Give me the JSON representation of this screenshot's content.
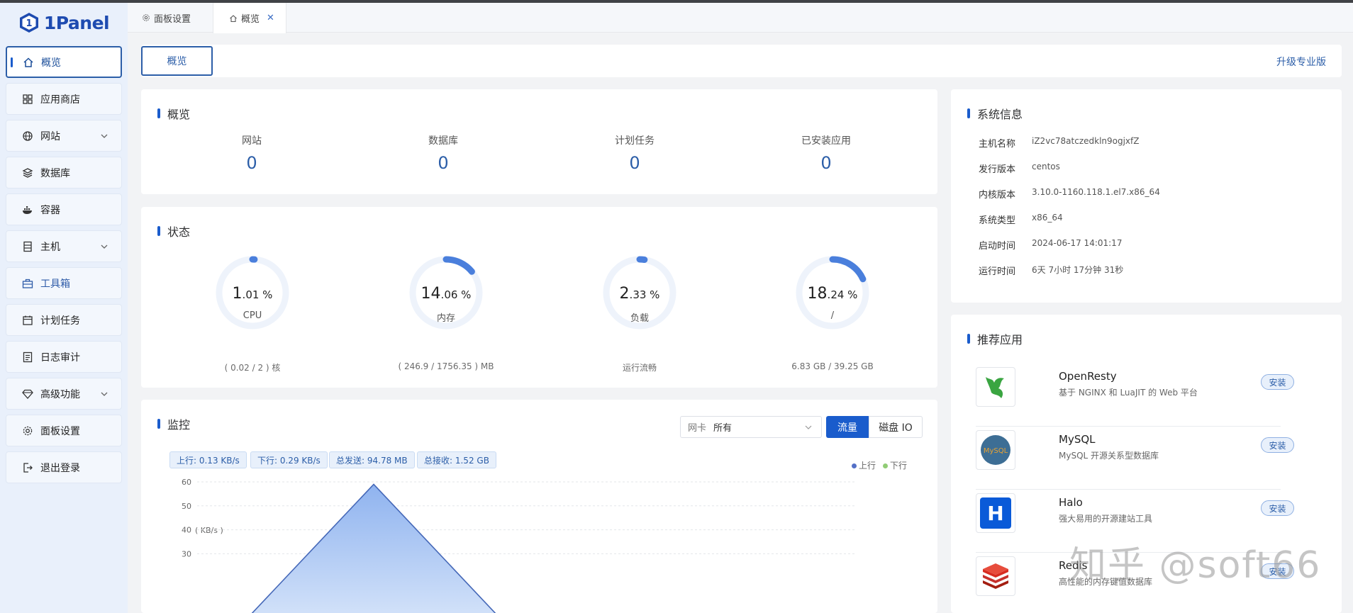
{
  "app": {
    "name": "1Panel"
  },
  "sidebar": {
    "items": [
      {
        "label": "概览",
        "icon": "home-icon"
      },
      {
        "label": "应用商店",
        "icon": "grid-icon"
      },
      {
        "label": "网站",
        "icon": "globe-icon"
      },
      {
        "label": "数据库",
        "icon": "layers-icon"
      },
      {
        "label": "容器",
        "icon": "docker-icon"
      },
      {
        "label": "主机",
        "icon": "server-icon"
      },
      {
        "label": "工具箱",
        "icon": "toolbox-icon"
      },
      {
        "label": "计划任务",
        "icon": "calendar-icon"
      },
      {
        "label": "日志审计",
        "icon": "log-icon"
      },
      {
        "label": "高级功能",
        "icon": "diamond-icon"
      },
      {
        "label": "面板设置",
        "icon": "gear-icon"
      },
      {
        "label": "退出登录",
        "icon": "logout-icon"
      }
    ]
  },
  "tabs": {
    "settings": "面板设置",
    "overview": "概览",
    "close": "✕"
  },
  "header": {
    "button": "概览",
    "upgrade": "升级专业版"
  },
  "overview": {
    "title": "概览",
    "stats": [
      {
        "label": "网站",
        "value": "0"
      },
      {
        "label": "数据库",
        "value": "0"
      },
      {
        "label": "计划任务",
        "value": "0"
      },
      {
        "label": "已安装应用",
        "value": "0"
      }
    ]
  },
  "status": {
    "title": "状态",
    "gauges": [
      {
        "int": "1",
        "dec": ".01 %",
        "name": "CPU",
        "sub": "( 0.02 / 2 ) 核",
        "percent": 1.01
      },
      {
        "int": "14",
        "dec": ".06 %",
        "name": "内存",
        "sub": "( 246.9 / 1756.35 ) MB",
        "percent": 14.06
      },
      {
        "int": "2",
        "dec": ".33 %",
        "name": "负载",
        "sub": "运行流畅",
        "percent": 2.33
      },
      {
        "int": "18",
        "dec": ".24 %",
        "name": "/",
        "sub": "6.83 GB / 39.25 GB",
        "percent": 18.24
      }
    ]
  },
  "monitor": {
    "title": "监控",
    "nic_label": "网卡",
    "nic_value": "所有",
    "btn_traffic": "流量",
    "btn_diskio": "磁盘 IO",
    "pills": [
      "上行: 0.13 KB/s",
      "下行: 0.29 KB/s",
      "总发送: 94.78 MB",
      "总接收: 1.52 GB"
    ],
    "legend": {
      "up": "上行",
      "down": "下行",
      "up_color": "#5470c6",
      "down_color": "#91cc75"
    }
  },
  "chart_data": {
    "type": "area",
    "ylabel": "( KB/s )",
    "ylim": [
      0,
      60
    ],
    "yticks": [
      "60",
      "50",
      "40",
      "30"
    ],
    "series": [
      {
        "name": "上行",
        "x": [
          0,
          1,
          2
        ],
        "values": [
          0,
          59,
          0
        ]
      },
      {
        "name": "下行",
        "x": [
          0,
          1,
          2
        ],
        "values": [
          0,
          0,
          0
        ]
      }
    ]
  },
  "sysinfo": {
    "title": "系统信息",
    "rows": [
      {
        "k": "主机名称",
        "v": "iZ2vc78atczedkln9ogjxfZ"
      },
      {
        "k": "发行版本",
        "v": "centos"
      },
      {
        "k": "内核版本",
        "v": "3.10.0-1160.118.1.el7.x86_64"
      },
      {
        "k": "系统类型",
        "v": "x86_64"
      },
      {
        "k": "启动时间",
        "v": "2024-06-17 14:01:17"
      },
      {
        "k": "运行时间",
        "v": "6天 7小时 17分钟 31秒"
      }
    ]
  },
  "apps": {
    "title": "推荐应用",
    "install": "安装",
    "items": [
      {
        "name": "OpenResty",
        "desc": "基于 NGINX 和 LuaJIT 的 Web 平台",
        "icon": "openresty-icon"
      },
      {
        "name": "MySQL",
        "desc": "MySQL 开源关系型数据库",
        "icon": "mysql-icon",
        "logo_text": "MySQL"
      },
      {
        "name": "Halo",
        "desc": "强大易用的开源建站工具",
        "icon": "halo-icon",
        "logo_text": "H"
      },
      {
        "name": "Redis",
        "desc": "高性能的内存键值数据库",
        "icon": "redis-icon"
      }
    ]
  },
  "watermark": "知乎 @soft66",
  "colors": {
    "accent": "#1a5ccc",
    "primary_text": "#2c5ea8"
  }
}
